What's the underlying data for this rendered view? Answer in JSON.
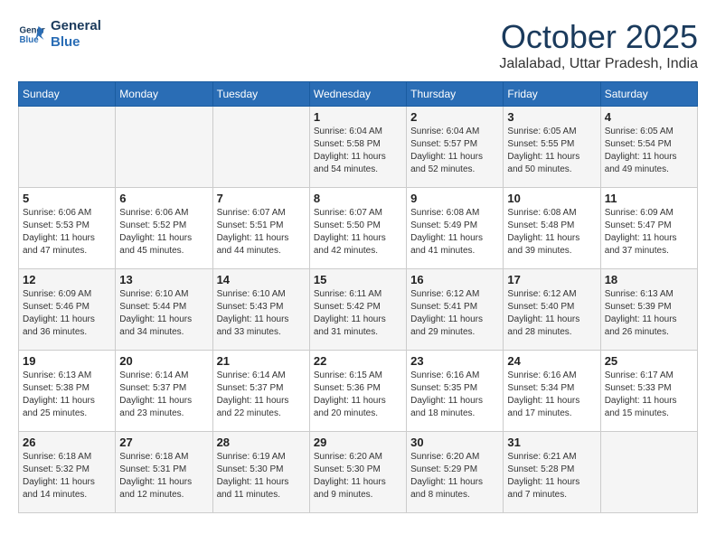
{
  "header": {
    "logo_line1": "General",
    "logo_line2": "Blue",
    "month": "October 2025",
    "location": "Jalalabad, Uttar Pradesh, India"
  },
  "weekdays": [
    "Sunday",
    "Monday",
    "Tuesday",
    "Wednesday",
    "Thursday",
    "Friday",
    "Saturday"
  ],
  "weeks": [
    [
      {
        "day": "",
        "info": ""
      },
      {
        "day": "",
        "info": ""
      },
      {
        "day": "",
        "info": ""
      },
      {
        "day": "1",
        "info": "Sunrise: 6:04 AM\nSunset: 5:58 PM\nDaylight: 11 hours\nand 54 minutes."
      },
      {
        "day": "2",
        "info": "Sunrise: 6:04 AM\nSunset: 5:57 PM\nDaylight: 11 hours\nand 52 minutes."
      },
      {
        "day": "3",
        "info": "Sunrise: 6:05 AM\nSunset: 5:55 PM\nDaylight: 11 hours\nand 50 minutes."
      },
      {
        "day": "4",
        "info": "Sunrise: 6:05 AM\nSunset: 5:54 PM\nDaylight: 11 hours\nand 49 minutes."
      }
    ],
    [
      {
        "day": "5",
        "info": "Sunrise: 6:06 AM\nSunset: 5:53 PM\nDaylight: 11 hours\nand 47 minutes."
      },
      {
        "day": "6",
        "info": "Sunrise: 6:06 AM\nSunset: 5:52 PM\nDaylight: 11 hours\nand 45 minutes."
      },
      {
        "day": "7",
        "info": "Sunrise: 6:07 AM\nSunset: 5:51 PM\nDaylight: 11 hours\nand 44 minutes."
      },
      {
        "day": "8",
        "info": "Sunrise: 6:07 AM\nSunset: 5:50 PM\nDaylight: 11 hours\nand 42 minutes."
      },
      {
        "day": "9",
        "info": "Sunrise: 6:08 AM\nSunset: 5:49 PM\nDaylight: 11 hours\nand 41 minutes."
      },
      {
        "day": "10",
        "info": "Sunrise: 6:08 AM\nSunset: 5:48 PM\nDaylight: 11 hours\nand 39 minutes."
      },
      {
        "day": "11",
        "info": "Sunrise: 6:09 AM\nSunset: 5:47 PM\nDaylight: 11 hours\nand 37 minutes."
      }
    ],
    [
      {
        "day": "12",
        "info": "Sunrise: 6:09 AM\nSunset: 5:46 PM\nDaylight: 11 hours\nand 36 minutes."
      },
      {
        "day": "13",
        "info": "Sunrise: 6:10 AM\nSunset: 5:44 PM\nDaylight: 11 hours\nand 34 minutes."
      },
      {
        "day": "14",
        "info": "Sunrise: 6:10 AM\nSunset: 5:43 PM\nDaylight: 11 hours\nand 33 minutes."
      },
      {
        "day": "15",
        "info": "Sunrise: 6:11 AM\nSunset: 5:42 PM\nDaylight: 11 hours\nand 31 minutes."
      },
      {
        "day": "16",
        "info": "Sunrise: 6:12 AM\nSunset: 5:41 PM\nDaylight: 11 hours\nand 29 minutes."
      },
      {
        "day": "17",
        "info": "Sunrise: 6:12 AM\nSunset: 5:40 PM\nDaylight: 11 hours\nand 28 minutes."
      },
      {
        "day": "18",
        "info": "Sunrise: 6:13 AM\nSunset: 5:39 PM\nDaylight: 11 hours\nand 26 minutes."
      }
    ],
    [
      {
        "day": "19",
        "info": "Sunrise: 6:13 AM\nSunset: 5:38 PM\nDaylight: 11 hours\nand 25 minutes."
      },
      {
        "day": "20",
        "info": "Sunrise: 6:14 AM\nSunset: 5:37 PM\nDaylight: 11 hours\nand 23 minutes."
      },
      {
        "day": "21",
        "info": "Sunrise: 6:14 AM\nSunset: 5:37 PM\nDaylight: 11 hours\nand 22 minutes."
      },
      {
        "day": "22",
        "info": "Sunrise: 6:15 AM\nSunset: 5:36 PM\nDaylight: 11 hours\nand 20 minutes."
      },
      {
        "day": "23",
        "info": "Sunrise: 6:16 AM\nSunset: 5:35 PM\nDaylight: 11 hours\nand 18 minutes."
      },
      {
        "day": "24",
        "info": "Sunrise: 6:16 AM\nSunset: 5:34 PM\nDaylight: 11 hours\nand 17 minutes."
      },
      {
        "day": "25",
        "info": "Sunrise: 6:17 AM\nSunset: 5:33 PM\nDaylight: 11 hours\nand 15 minutes."
      }
    ],
    [
      {
        "day": "26",
        "info": "Sunrise: 6:18 AM\nSunset: 5:32 PM\nDaylight: 11 hours\nand 14 minutes."
      },
      {
        "day": "27",
        "info": "Sunrise: 6:18 AM\nSunset: 5:31 PM\nDaylight: 11 hours\nand 12 minutes."
      },
      {
        "day": "28",
        "info": "Sunrise: 6:19 AM\nSunset: 5:30 PM\nDaylight: 11 hours\nand 11 minutes."
      },
      {
        "day": "29",
        "info": "Sunrise: 6:20 AM\nSunset: 5:30 PM\nDaylight: 11 hours\nand 9 minutes."
      },
      {
        "day": "30",
        "info": "Sunrise: 6:20 AM\nSunset: 5:29 PM\nDaylight: 11 hours\nand 8 minutes."
      },
      {
        "day": "31",
        "info": "Sunrise: 6:21 AM\nSunset: 5:28 PM\nDaylight: 11 hours\nand 7 minutes."
      },
      {
        "day": "",
        "info": ""
      }
    ]
  ]
}
